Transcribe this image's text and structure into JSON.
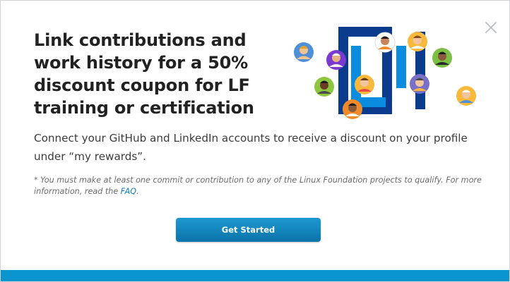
{
  "modal": {
    "headline": "Link contributions and work history for a 50% discount coupon for LF training or certification",
    "subtext": "Connect your GitHub and LinkedIn accounts to receive a discount on your profile under “my rewards”.",
    "note_prefix": "* You must make at least one commit or contribution to any of the Linux Foundation projects to qualify. For more information, read the ",
    "note_link": "FAQ",
    "note_suffix": ".",
    "cta_label": "Get Started",
    "close_icon": "close-icon"
  },
  "colors": {
    "accent": "#0b95cf",
    "link": "#0b7fb8",
    "illustration_blue": "#0a8ce0",
    "illustration_navy": "#0b3b8c"
  },
  "illustration": {
    "icon": "community-avatars-illustration"
  }
}
